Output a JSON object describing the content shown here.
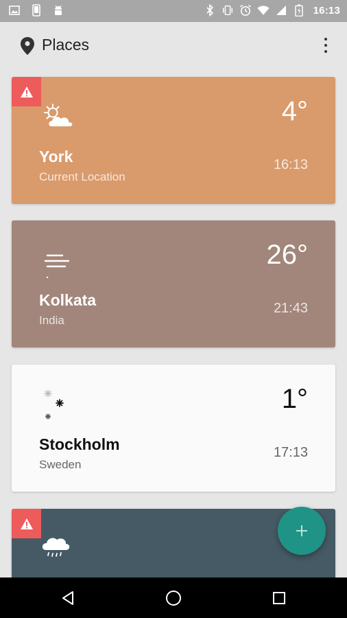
{
  "status_bar": {
    "time": "16:13",
    "left_icons": [
      "image-icon",
      "phone-icon",
      "android-icon"
    ],
    "right_icons": [
      "bluetooth-icon",
      "vibrate-icon",
      "alarm-icon",
      "wifi-icon",
      "signal-icon",
      "battery-icon"
    ]
  },
  "app_bar": {
    "title": "Places",
    "pin_icon": "location-pin-icon",
    "menu_icon": "more-vert-icon"
  },
  "places": [
    {
      "city": "York",
      "subtitle": "Current Location",
      "temp": "4°",
      "time": "16:13",
      "alert": true,
      "icon": "partly-cloudy-icon",
      "color": "#d99a6c"
    },
    {
      "city": "Kolkata",
      "subtitle": "India",
      "temp": "26°",
      "time": "21:43",
      "alert": false,
      "icon": "haze-icon",
      "color": "#a2867b"
    },
    {
      "city": "Stockholm",
      "subtitle": "Sweden",
      "temp": "1°",
      "time": "17:13",
      "alert": false,
      "icon": "snow-icon",
      "color": "#fafafa"
    },
    {
      "alert": true,
      "icon": "rain-icon",
      "color": "#455a64"
    }
  ],
  "fab": {
    "icon": "plus-icon",
    "color": "#1f9486"
  },
  "nav_bar": {
    "buttons": [
      "back-icon",
      "home-icon",
      "recents-icon"
    ]
  }
}
